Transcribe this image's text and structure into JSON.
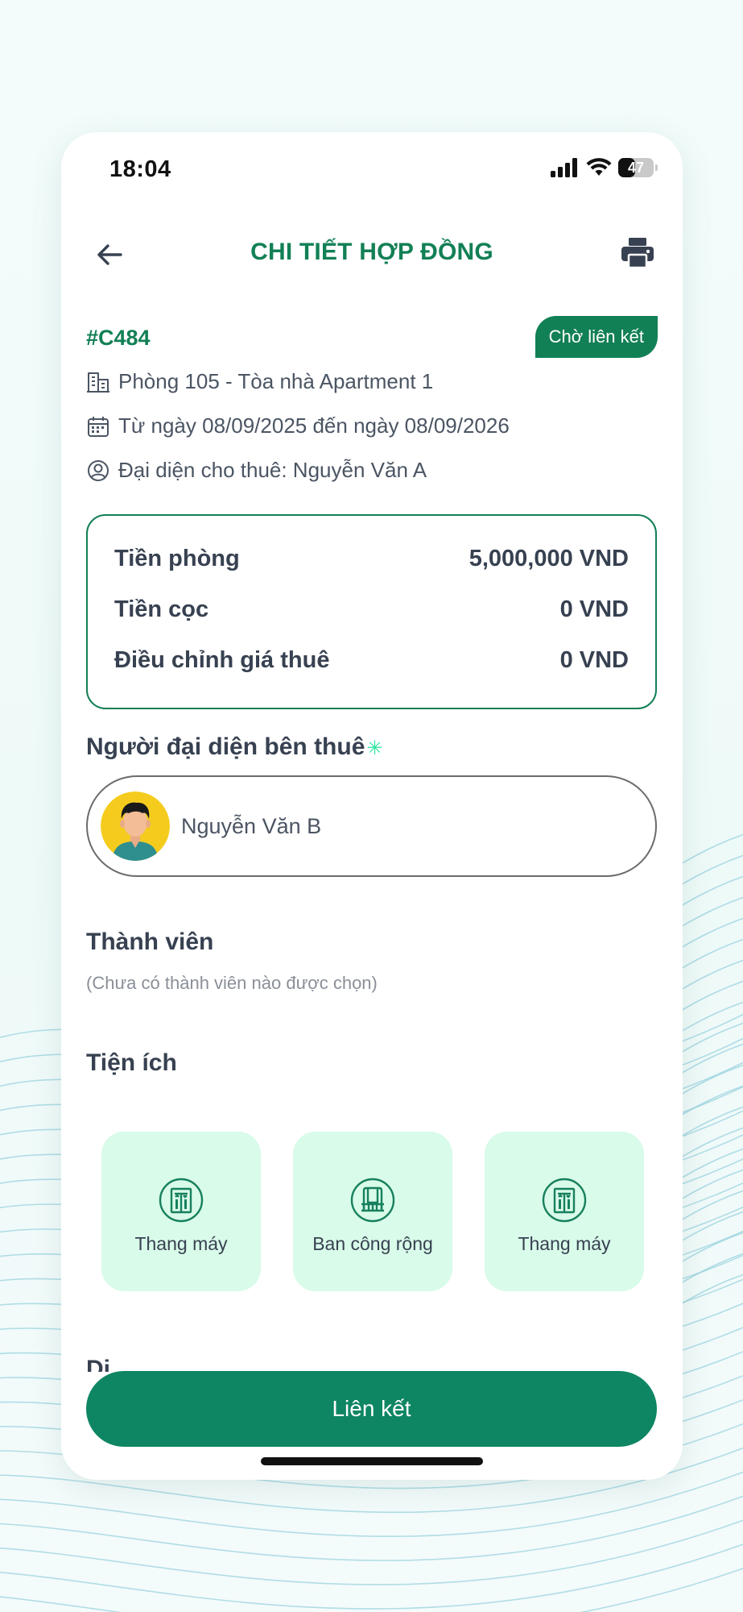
{
  "status_bar": {
    "time": "18:04",
    "battery": "47",
    "battery_level_percent": 47
  },
  "header": {
    "title": "CHI TIẾT HỢP ĐỒNG"
  },
  "contract": {
    "id": "#C484",
    "status": "Chờ liên kết",
    "room": "Phòng 105 - Tòa nhà Apartment 1",
    "period": "Từ ngày 08/09/2025 đến ngày 08/09/2026",
    "landlord_rep": "Đại diện cho thuê: Nguyễn Văn A"
  },
  "prices": [
    {
      "label": "Tiền phòng",
      "value": "5,000,000 VND"
    },
    {
      "label": "Tiền cọc",
      "value": "0 VND"
    },
    {
      "label": "Điều chỉnh giá thuê",
      "value": "0 VND"
    }
  ],
  "tenant_rep": {
    "title": "Người đại diện bên thuê",
    "required_mark": "✳",
    "name": "Nguyễn Văn B"
  },
  "members": {
    "title": "Thành viên",
    "empty_text": "(Chưa có thành viên nào được chọn)"
  },
  "amenities": {
    "title": "Tiện ích",
    "items": [
      {
        "label": "Thang máy",
        "icon": "elevator-icon"
      },
      {
        "label": "Ban công rộng",
        "icon": "balcony-icon"
      },
      {
        "label": "Thang máy",
        "icon": "elevator-icon"
      }
    ]
  },
  "next_section_partial": "Dị",
  "actions": {
    "link_label": "Liên kết"
  },
  "colors": {
    "primary": "#128055",
    "button": "#0e8563",
    "amenity_bg": "#d9fbe9",
    "accent_star": "#2ee6a0"
  }
}
